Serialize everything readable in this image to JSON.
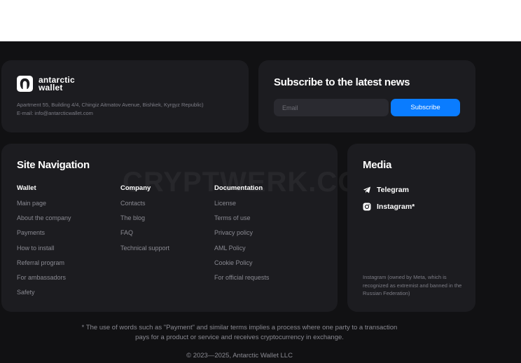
{
  "brand": {
    "name_line1": "antarctic",
    "name_line2": "wallet",
    "address": "Apartment 55, Building 4/4, Chingiz Aitmatov Avenue, Bishkek, Kyrgyz Republic)",
    "email": "E-mail: info@antarcticwallet.com",
    "icon": "antarctic-logo-icon"
  },
  "subscribe": {
    "title": "Subscribe to the latest news",
    "placeholder": "Email",
    "button_label": "Subscribe"
  },
  "navigation": {
    "title": "Site Navigation",
    "columns": [
      {
        "heading": "Wallet",
        "items": [
          "Main page",
          "About the company",
          "Payments",
          "How to install",
          "Referral program",
          "For ambassadors",
          "Safety"
        ]
      },
      {
        "heading": "Company",
        "items": [
          "Contacts",
          "The blog",
          "FAQ",
          "Technical support"
        ]
      },
      {
        "heading": "Documentation",
        "items": [
          "License",
          "Terms of use",
          "Privacy policy",
          "AML Policy",
          "Cookie Policy",
          "For official requests"
        ]
      }
    ]
  },
  "watermark": "CRYPTWERK.COM",
  "media": {
    "title": "Media",
    "links": [
      {
        "label": "Telegram",
        "icon": "telegram-icon"
      },
      {
        "label": "Instagram*",
        "icon": "instagram-icon"
      }
    ],
    "note": "Instagram (owned by Meta, which is recognized as extremist and banned in the Russian Federation)"
  },
  "footer": {
    "disclaimer_line1": "* The use of words such as \"Payment\" and similar terms implies a process where one party to a transaction",
    "disclaimer_line2": "pays for a product or service and receives cryptocurrency in exchange.",
    "copyright": "© 2023—2025, Antarctic Wallet LLC"
  },
  "colors": {
    "background": "#111113",
    "card": "#1c1c20",
    "accent": "#0a7cff",
    "muted_text": "#8a8a92"
  }
}
